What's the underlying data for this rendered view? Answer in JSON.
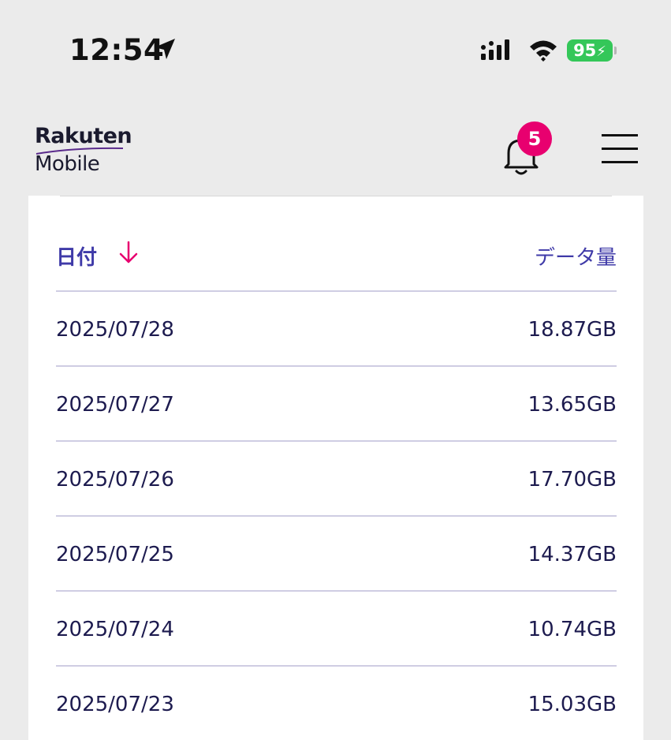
{
  "status_bar": {
    "time": "12:54",
    "battery": "95",
    "icons": [
      "location-arrow-icon",
      "signal-icon",
      "wifi-icon",
      "battery-charging-icon"
    ]
  },
  "header": {
    "logo_top": "Rakuten",
    "logo_bottom": "Mobile",
    "notification_count": "5",
    "icons": [
      "bell-icon",
      "hamburger-menu-icon"
    ]
  },
  "table": {
    "columns": {
      "date": "日付",
      "data": "データ量"
    },
    "sort_icon": "arrow-down-icon",
    "rows": [
      {
        "date": "2025/07/28",
        "data": "18.87GB"
      },
      {
        "date": "2025/07/27",
        "data": "13.65GB"
      },
      {
        "date": "2025/07/26",
        "data": "17.70GB"
      },
      {
        "date": "2025/07/25",
        "data": "14.37GB"
      },
      {
        "date": "2025/07/24",
        "data": "10.74GB"
      },
      {
        "date": "2025/07/23",
        "data": "15.03GB"
      }
    ]
  },
  "colors": {
    "accent": "#3f3aa8",
    "badge": "#e8006f",
    "battery": "#34c759",
    "text": "#1d1b4f"
  }
}
